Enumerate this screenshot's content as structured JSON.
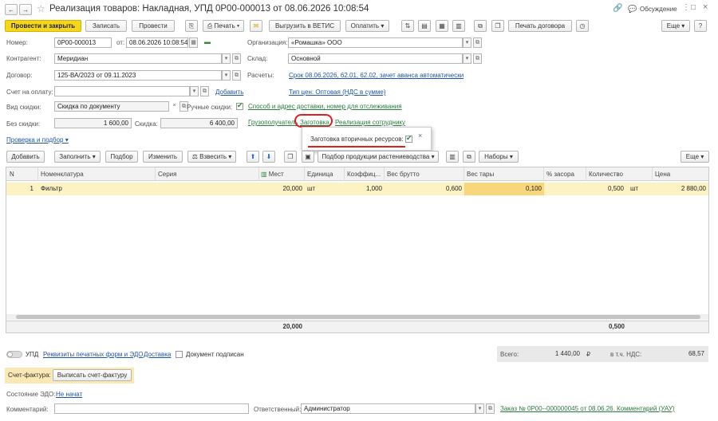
{
  "window": {
    "title": "Реализация товаров: Накладная, УПД 0Р00-000013 от 08.06.2026 10:08:54",
    "discuss": "Обсуждение"
  },
  "toolbar": {
    "post_close": "Провести и закрыть",
    "save": "Записать",
    "post": "Провести",
    "print": "Печать",
    "vetis": "Выгрузить в ВЕТИС",
    "pay": "Оплатить",
    "print_contract": "Печать договора",
    "more": "Еще"
  },
  "form": {
    "number_label": "Номер:",
    "number": "0Р00-000013",
    "date_from": "от:",
    "date": "08.06.2026 10:08:54",
    "org_label": "Организация:",
    "org": "«Ромашка» ООО",
    "counterparty_label": "Контрагент:",
    "counterparty": "Меридиан",
    "warehouse_label": "Склад:",
    "warehouse": "Основной",
    "contract_label": "Договор:",
    "contract": "125-ВА/2023 от 09.11.2023",
    "settlements_label": "Расчеты:",
    "settlements": "Срок 08.06.2026, 62.01, 62.02, зачет аванса автоматически",
    "invoice_label": "Счет на оплату:",
    "add": "Добавить",
    "price_type": "Тип цен: Оптовая (НДС в сумме)",
    "discount_type_label": "Вид скидки:",
    "discount_type": "Скидка по документу",
    "manual_disc": "Ручные скидки:",
    "delivery": "Способ и адрес доставки, номер для отслеживания",
    "no_discount_label": "Без скидки:",
    "no_discount": "1 600,00",
    "discount_label": "Скидка:",
    "discount": "6 400,00",
    "consignee": "Грузополучатель",
    "procurement": "Заготовка",
    "employee_sale": "Реализация сотруднику",
    "check": "Проверка и подбор"
  },
  "popup": {
    "label": "Заготовка вторичных ресурсов:",
    "close": "×"
  },
  "table_toolbar": {
    "add": "Добавить",
    "fill": "Заполнить",
    "pick": "Подбор",
    "change": "Изменить",
    "weigh": "Взвесить",
    "plant_pick": "Подбор продукции растениеводства",
    "sets": "Наборы",
    "more": "Еще"
  },
  "table": {
    "headers": [
      "N",
      "Номенклатура",
      "Серия",
      "Мест",
      "Единица",
      "Коэффиц...",
      "Вес брутто",
      "Вес тары",
      "% засора",
      "Количество",
      "Цена"
    ],
    "rows": [
      {
        "n": "1",
        "item": "Фильтр",
        "series": "",
        "places": "20,000",
        "unit": "шт",
        "coef": "1,000",
        "gross": "0,600",
        "tare": "0,100",
        "litter": "",
        "qty": "0,500",
        "qty_unit": "шт",
        "price": "2 880,00"
      }
    ],
    "footer_places": "20,000",
    "footer_qty": "0,500"
  },
  "bottom": {
    "upd": "УПД",
    "print_forms": "Реквизиты печатных форм и ЭДО",
    "delivery": "Доставка",
    "signed": "Документ подписан",
    "total_label": "Всего:",
    "total": "1 440,00",
    "currency": "₽",
    "vat_label": "в т.ч. НДС:",
    "vat": "68,57",
    "invoice_label": "Счет-фактура:",
    "invoice_btn": "Выписать счет-фактуру",
    "edo_label": "Состояние ЭДО:",
    "edo": "Не начат",
    "comment_label": "Комментарий:",
    "responsible_label": "Ответственный:",
    "responsible": "Администратор",
    "order": "Заказ № 0Р00--000000045 от 08.06.26. Комментарий (УАУ)"
  }
}
